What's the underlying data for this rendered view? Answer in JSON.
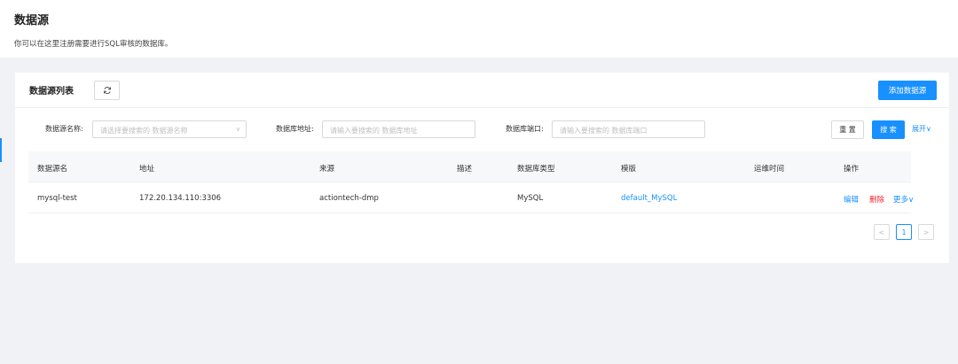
{
  "header": {
    "title": "数据源",
    "description": "你可以在这里注册需要进行SQL审核的数据库。"
  },
  "card": {
    "title": "数据源列表",
    "refresh_icon": "refresh-icon",
    "add_button": "添加数据源"
  },
  "filters": {
    "name_label": "数据源名称:",
    "name_placeholder": "请选择要搜索的 数据源名称",
    "host_label": "数据库地址:",
    "host_placeholder": "请输入要搜索的 数据库地址",
    "port_label": "数据库端口:",
    "port_placeholder": "请输入要搜索的 数据库端口",
    "reset_button": "重 置",
    "search_button": "搜 索",
    "expand_link": "展开∨"
  },
  "table": {
    "columns": [
      "数据源名",
      "地址",
      "来源",
      "描述",
      "数据库类型",
      "模版",
      "运维时间",
      "操作"
    ],
    "rows": [
      {
        "name": "mysql-test",
        "address": "172.20.134.110:3306",
        "source": "actiontech-dmp",
        "description": "",
        "db_type": "MySQL",
        "template": "default_MySQL",
        "maintenance_time": "",
        "actions": {
          "edit": "编辑",
          "delete": "删除",
          "more": "更多∨"
        }
      }
    ]
  },
  "pagination": {
    "prev": "<",
    "current_page": "1",
    "next": ">"
  },
  "colors": {
    "primary": "#1890ff",
    "danger": "#f5222d",
    "background": "#f0f2f5"
  }
}
